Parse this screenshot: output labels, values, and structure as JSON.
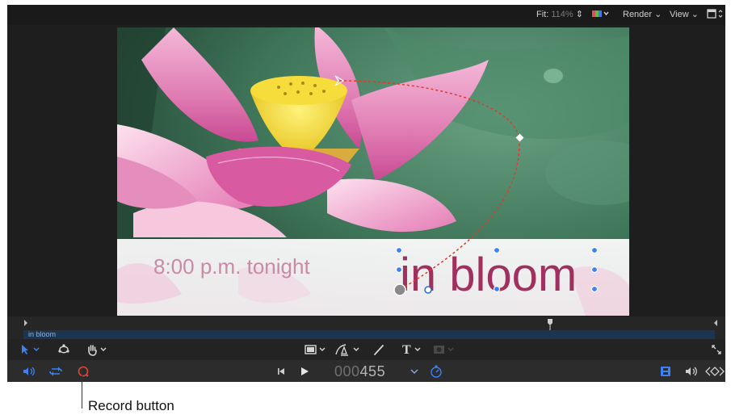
{
  "topbar": {
    "fit_label": "Fit:",
    "fit_value": "114%",
    "render_label": "Render",
    "view_label": "View"
  },
  "canvas": {
    "overlay_subtitle": "8:00 p.m. tonight",
    "overlay_title": "in bloom"
  },
  "timeline": {
    "clip_label": "in bloom"
  },
  "transport": {
    "timecode_dim": "000",
    "timecode_value": "455"
  },
  "callout": {
    "label": "Record button"
  },
  "colors": {
    "accent": "#3b82f6",
    "record": "#e0453a",
    "title": "#a0315f",
    "path": "#e03a2a"
  }
}
